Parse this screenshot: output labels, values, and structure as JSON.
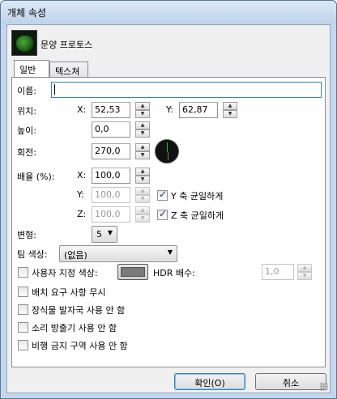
{
  "window": {
    "title": "개체 속성"
  },
  "header": {
    "object_name": "문양 프로토스"
  },
  "tabs": [
    {
      "label": "일반",
      "active": true
    },
    {
      "label": "텍스쳐",
      "active": false
    }
  ],
  "general": {
    "name_label": "이름:",
    "name_value": "",
    "position_label": "위치:",
    "x_label": "X:",
    "x_value": "52,53",
    "y_label": "Y:",
    "y_value": "62,87",
    "height_label": "높이:",
    "height_value": "0,0",
    "rotation_label": "회전:",
    "rotation_value": "270,0",
    "scale_label": "배율 (%):",
    "scale_x_label": "X:",
    "scale_x_value": "100,0",
    "scale_y_label": "Y:",
    "scale_y_value": "100,0",
    "scale_z_label": "Z:",
    "scale_z_value": "100,0",
    "y_uniform_label": "Y 축 균일하게",
    "y_uniform_checked": true,
    "z_uniform_label": "Z 축 균일하게",
    "z_uniform_checked": true,
    "variation_label": "변형:",
    "variation_value": "5",
    "team_color_label": "팀 색상:",
    "team_color_value": "(없음)",
    "custom_color_label": "사용자 지정 색상:",
    "custom_color_swatch": "#7a7a7a",
    "hdr_label": "HDR 배수:",
    "hdr_value": "1,0",
    "ignore_placement_label": "배치 요구 사항 무시",
    "no_footprint_label": "장식물 발자국 사용 안 함",
    "no_sound_label": "소리 방출기 사용 안 함",
    "no_fly_label": "비행 금지 구역 사용 안 함"
  },
  "buttons": {
    "ok": "확인(O)",
    "cancel": "취소"
  }
}
